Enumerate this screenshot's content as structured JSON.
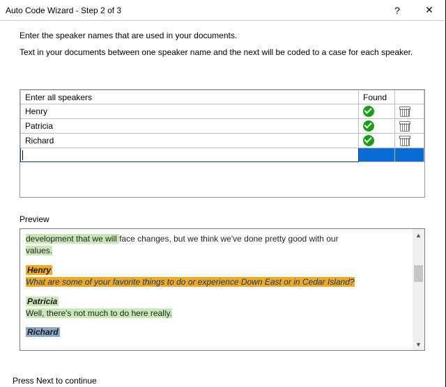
{
  "window": {
    "title": "Auto Code Wizard - Step 2 of 3",
    "help_label": "?",
    "close_label": "✕"
  },
  "instructions": {
    "line1": "Enter the speaker names that are used in your documents.",
    "line2": "Text in your documents between one speaker name and the next will be coded to a case for each speaker."
  },
  "speakers_table": {
    "header_name": "Enter all speakers",
    "header_found": "Found",
    "rows": [
      {
        "name": "Henry",
        "found": true
      },
      {
        "name": "Patricia",
        "found": true
      },
      {
        "name": "Richard",
        "found": true
      }
    ],
    "new_row_value": ""
  },
  "preview": {
    "label": "Preview",
    "frag_top_1": "development that we will ",
    "frag_top_2": "face changes, but we think we've done pretty good with our",
    "frag_top_3": "values.",
    "henry_name": "Henry",
    "henry_q": "What are some of your favorite things to do or experience Down East or in Cedar Island?",
    "patricia_name": "Patricia",
    "patricia_line": "Well, there's not much to do here really.",
    "richard_name": "Richard"
  },
  "footer": {
    "text": "Press Next to continue"
  }
}
